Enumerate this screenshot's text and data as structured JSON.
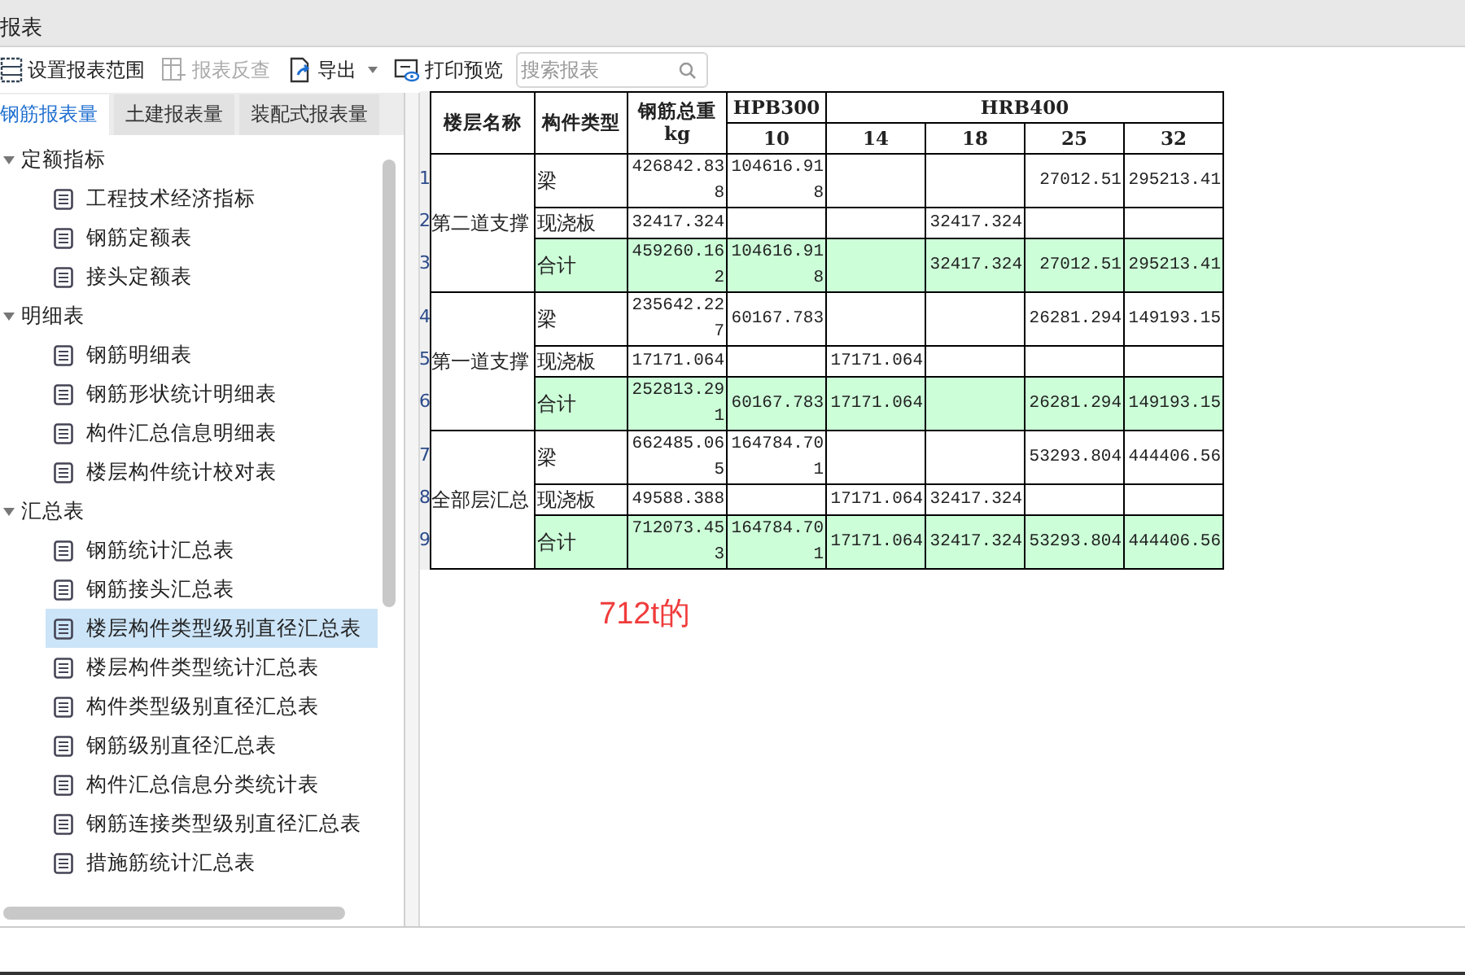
{
  "window": {
    "title": "报表"
  },
  "toolbar": {
    "buttons": [
      {
        "label": "设置报表范围",
        "kind": "range",
        "disabled": false,
        "dropdown": false
      },
      {
        "label": "报表反查",
        "kind": "lookup",
        "disabled": true,
        "dropdown": false
      },
      {
        "label": "导出",
        "kind": "export",
        "disabled": false,
        "dropdown": true
      },
      {
        "label": "打印预览",
        "kind": "print",
        "disabled": false,
        "dropdown": false
      }
    ],
    "search": {
      "placeholder": "搜索报表"
    }
  },
  "tabs": [
    {
      "label": "钢筋报表量",
      "selected": true
    },
    {
      "label": "土建报表量",
      "selected": false
    },
    {
      "label": "装配式报表量",
      "selected": false
    }
  ],
  "tree": [
    {
      "label": "定额指标",
      "expanded": true,
      "children": [
        {
          "label": "工程技术经济指标",
          "selected": false
        },
        {
          "label": "钢筋定额表",
          "selected": false
        },
        {
          "label": "接头定额表",
          "selected": false
        }
      ]
    },
    {
      "label": "明细表",
      "expanded": true,
      "children": [
        {
          "label": "钢筋明细表",
          "selected": false
        },
        {
          "label": "钢筋形状统计明细表",
          "selected": false
        },
        {
          "label": "构件汇总信息明细表",
          "selected": false
        },
        {
          "label": "楼层构件统计校对表",
          "selected": false
        }
      ]
    },
    {
      "label": "汇总表",
      "expanded": true,
      "children": [
        {
          "label": "钢筋统计汇总表",
          "selected": false
        },
        {
          "label": "钢筋接头汇总表",
          "selected": false
        },
        {
          "label": "楼层构件类型级别直径汇总表",
          "selected": true
        },
        {
          "label": "楼层构件类型统计汇总表",
          "selected": false
        },
        {
          "label": "构件类型级别直径汇总表",
          "selected": false
        },
        {
          "label": "钢筋级别直径汇总表",
          "selected": false
        },
        {
          "label": "构件汇总信息分类统计表",
          "selected": false
        },
        {
          "label": "钢筋连接类型级别直径汇总表",
          "selected": false
        },
        {
          "label": "措施筋统计汇总表",
          "selected": false
        }
      ]
    }
  ],
  "table": {
    "columns": {
      "floor": "楼层名称",
      "type": "构件类型",
      "total": "钢筋总重",
      "total_unit": "kg"
    },
    "grades": [
      {
        "grade": "HPB300",
        "diameters": [
          "10"
        ]
      },
      {
        "grade": "HRB400",
        "diameters": [
          "14",
          "18",
          "25",
          "32"
        ]
      }
    ],
    "groups": [
      {
        "floor": "第二道支撑",
        "rows": [
          {
            "row_number": "1",
            "kind": "item",
            "type": "梁",
            "total": "426842.838",
            "values": {
              "10": "104616.918",
              "25": "27012.51",
              "32": "295213.41"
            }
          },
          {
            "row_number": "2",
            "kind": "item",
            "type": "现浇板",
            "total": "32417.324",
            "values": {
              "18": "32417.324"
            }
          },
          {
            "row_number": "3",
            "kind": "total",
            "type": "合计",
            "total": "459260.162",
            "values": {
              "10": "104616.918",
              "18": "32417.324",
              "25": "27012.51",
              "32": "295213.41"
            }
          }
        ]
      },
      {
        "floor": "第一道支撑",
        "rows": [
          {
            "row_number": "4",
            "kind": "item",
            "type": "梁",
            "total": "235642.227",
            "values": {
              "10": "60167.783",
              "25": "26281.294",
              "32": "149193.15"
            }
          },
          {
            "row_number": "5",
            "kind": "item",
            "type": "现浇板",
            "total": "17171.064",
            "values": {
              "14": "17171.064"
            }
          },
          {
            "row_number": "6",
            "kind": "total",
            "type": "合计",
            "total": "252813.291",
            "values": {
              "10": "60167.783",
              "14": "17171.064",
              "25": "26281.294",
              "32": "149193.15"
            }
          }
        ]
      },
      {
        "floor": "全部层汇总",
        "rows": [
          {
            "row_number": "7",
            "kind": "item",
            "type": "梁",
            "total": "662485.065",
            "values": {
              "10": "164784.701",
              "25": "53293.804",
              "32": "444406.56"
            }
          },
          {
            "row_number": "8",
            "kind": "item",
            "type": "现浇板",
            "total": "49588.388",
            "values": {
              "14": "17171.064",
              "18": "32417.324"
            }
          },
          {
            "row_number": "9",
            "kind": "total",
            "type": "合计",
            "total": "712073.453",
            "values": {
              "10": "164784.701",
              "14": "17171.064",
              "18": "32417.324",
              "25": "53293.804",
              "32": "444406.56"
            }
          }
        ]
      }
    ]
  },
  "annotation": "712t的"
}
